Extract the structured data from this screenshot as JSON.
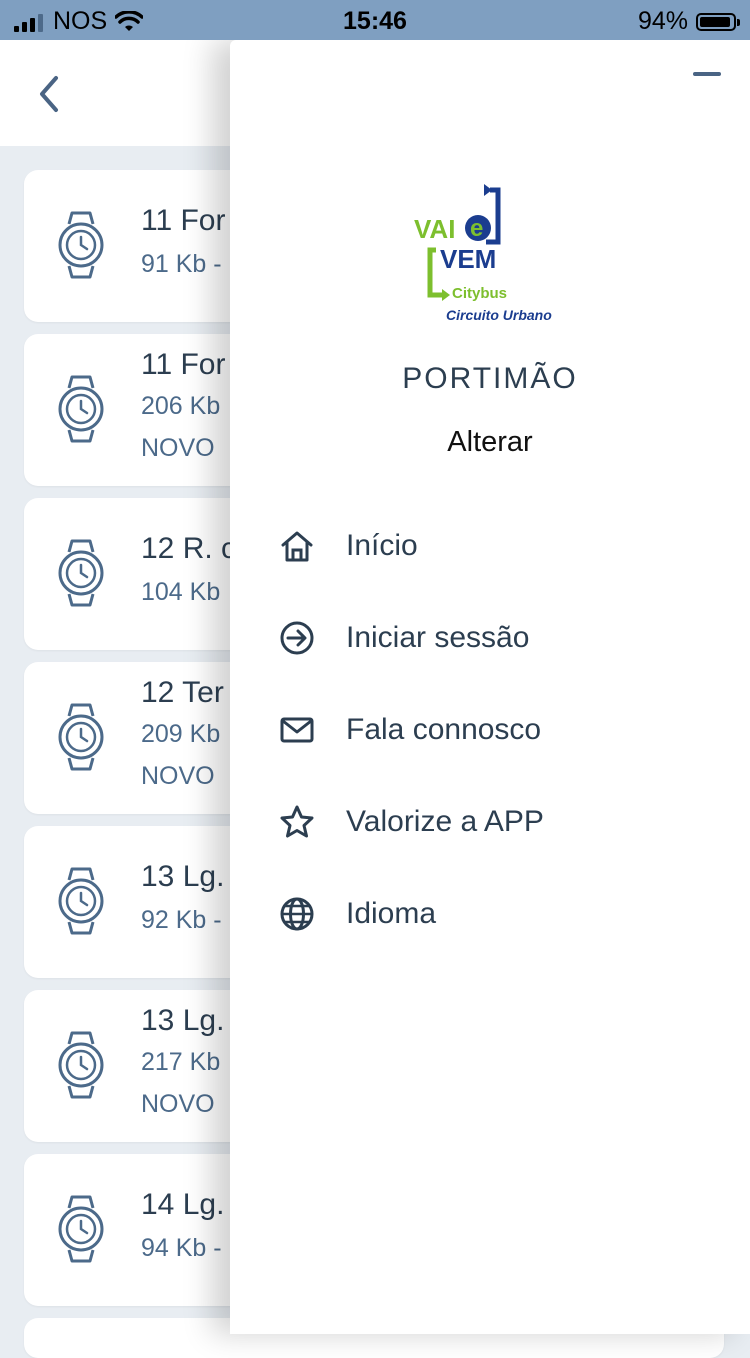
{
  "status_bar": {
    "carrier": "NOS",
    "time": "15:46",
    "battery": "94%",
    "battery_level": 0.94
  },
  "list": {
    "items": [
      {
        "title": "11 For",
        "size": "91 Kb -",
        "tag": ""
      },
      {
        "title": "11 For",
        "size": "206 Kb",
        "tag": "NOVO"
      },
      {
        "title": "12 R. c",
        "size": "104 Kb",
        "tag": ""
      },
      {
        "title": "12 Ter",
        "size": "209 Kb",
        "tag": "NOVO"
      },
      {
        "title": "13 Lg.",
        "size": "92 Kb -",
        "tag": ""
      },
      {
        "title": "13 Lg.",
        "size": "217 Kb",
        "tag": "NOVO"
      },
      {
        "title": "14 Lg.",
        "size": "94 Kb -",
        "tag": ""
      }
    ]
  },
  "drawer": {
    "logo": {
      "line1": "VAI",
      "line2": "e",
      "line3": "VEM",
      "line4": "Citybus",
      "line5": "Circuito Urbano"
    },
    "city": "PORTIMÃO",
    "change_label": "Alterar",
    "menu": [
      {
        "label": "Início",
        "icon": "home-icon"
      },
      {
        "label": "Iniciar sessão",
        "icon": "login-icon"
      },
      {
        "label": "Fala connosco",
        "icon": "mail-icon"
      },
      {
        "label": "Valorize a APP",
        "icon": "star-icon"
      },
      {
        "label": "Idioma",
        "icon": "globe-icon"
      }
    ]
  },
  "colors": {
    "status_bar": "#7f9fc1",
    "text_dark": "#2c3e50",
    "text_muted": "#4c6a8a",
    "logo_green": "#7dbf2e",
    "logo_blue": "#1b3d8f"
  }
}
